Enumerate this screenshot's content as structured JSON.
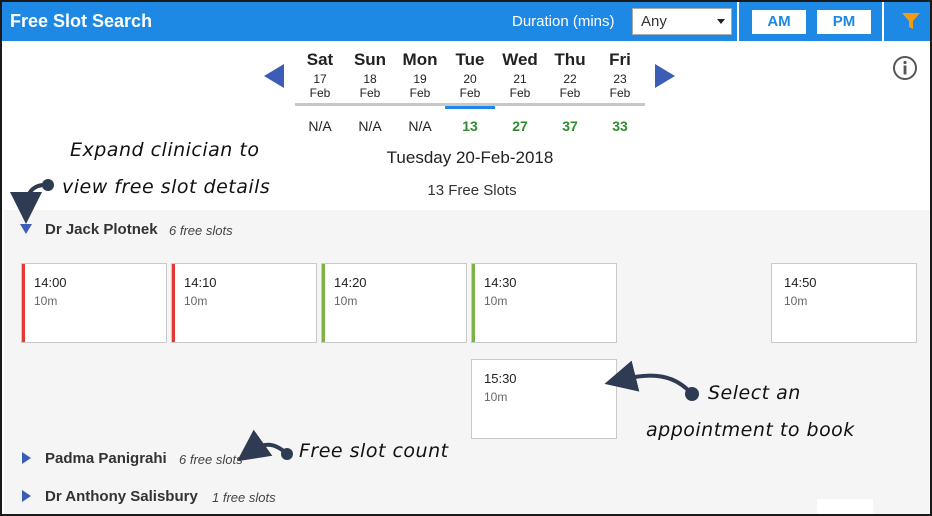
{
  "header": {
    "title": "Free Slot Search",
    "duration_label": "Duration (mins)",
    "duration_value": "Any",
    "am_label": "AM",
    "pm_label": "PM",
    "brand_color": "#1e88e5"
  },
  "week": {
    "days": [
      {
        "name": "Sat",
        "date": "17",
        "month": "Feb",
        "count": "N/A"
      },
      {
        "name": "Sun",
        "date": "18",
        "month": "Feb",
        "count": "N/A"
      },
      {
        "name": "Mon",
        "date": "19",
        "month": "Feb",
        "count": "N/A"
      },
      {
        "name": "Tue",
        "date": "20",
        "month": "Feb",
        "count": "13",
        "selected": true
      },
      {
        "name": "Wed",
        "date": "21",
        "month": "Feb",
        "count": "27"
      },
      {
        "name": "Thu",
        "date": "22",
        "month": "Feb",
        "count": "37"
      },
      {
        "name": "Fri",
        "date": "23",
        "month": "Feb",
        "count": "33"
      }
    ]
  },
  "selected_date": "Tuesday 20-Feb-2018",
  "free_slots_total": "13 Free Slots",
  "clinicians": [
    {
      "name": "Dr Jack Plotnek",
      "count": "6 free slots",
      "expanded": true,
      "slots": [
        {
          "time": "14:00",
          "duration": "10m",
          "status_color": "#e53935"
        },
        {
          "time": "14:10",
          "duration": "10m",
          "status_color": "#e53935"
        },
        {
          "time": "14:20",
          "duration": "10m",
          "status_color": "#7cb342"
        },
        {
          "time": "14:30",
          "duration": "10m",
          "status_color": "#7cb342"
        },
        {
          "time": "14:50",
          "duration": "10m",
          "status_color": ""
        },
        {
          "time": "15:30",
          "duration": "10m",
          "status_color": ""
        }
      ]
    },
    {
      "name": "Padma Panigrahi",
      "count": "6 free slots",
      "expanded": false
    },
    {
      "name": "Dr Anthony Salisbury",
      "count": "1 free slots",
      "expanded": false
    }
  ],
  "annotations": {
    "expand_line1": "Expand clinician to",
    "expand_line2": "view free slot details",
    "select_line1": "Select an",
    "select_line2": "appointment to book",
    "count_note": "Free slot count"
  }
}
